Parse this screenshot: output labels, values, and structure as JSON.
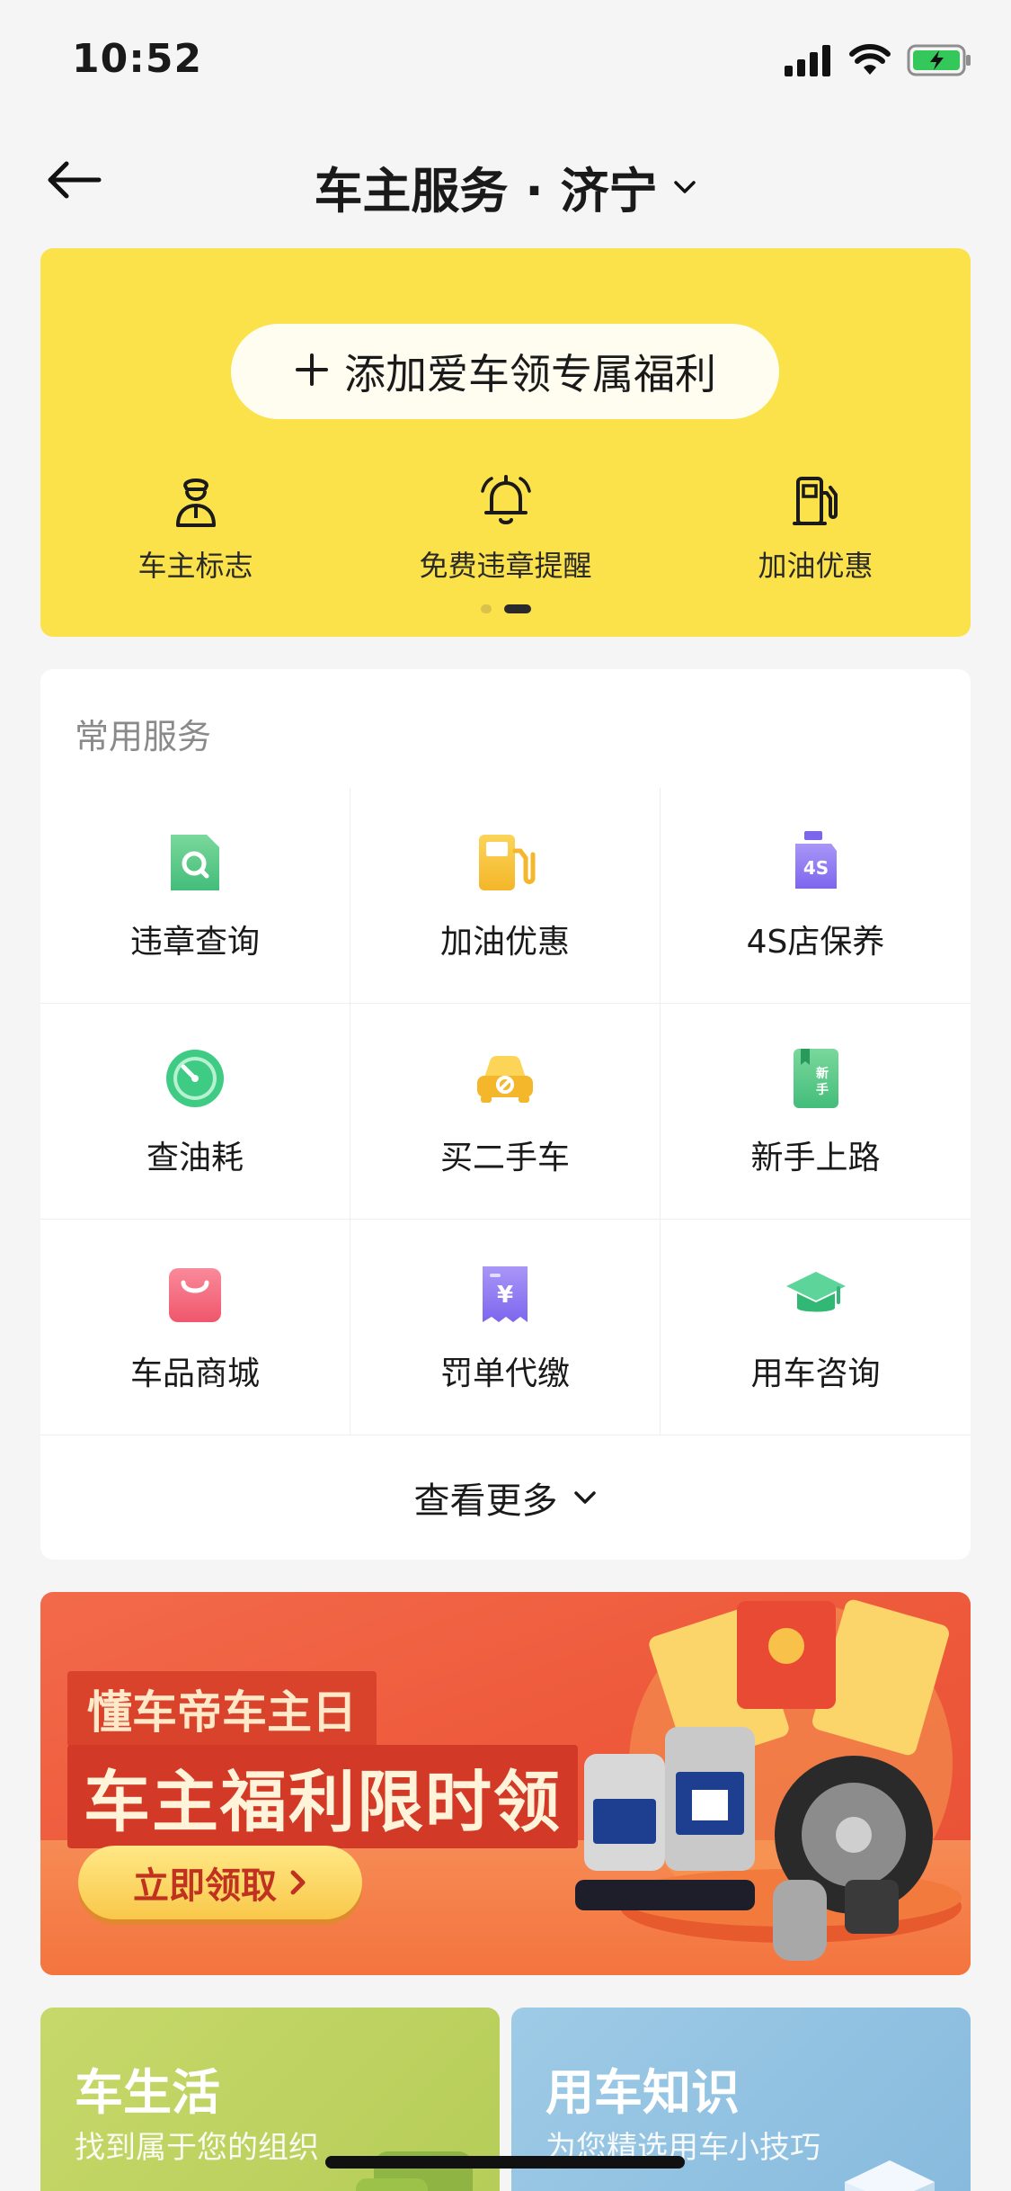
{
  "status_bar": {
    "time": "10:52"
  },
  "nav": {
    "title": "车主服务 · 济宁"
  },
  "welfare": {
    "add_button_label": "添加爱车领专属福利",
    "quick_items": [
      {
        "label": "车主标志",
        "icon": "driver-icon"
      },
      {
        "label": "免费违章提醒",
        "icon": "bell-icon"
      },
      {
        "label": "加油优惠",
        "icon": "fuel-pump-icon"
      }
    ]
  },
  "services": {
    "section_title": "常用服务",
    "items": [
      {
        "label": "违章查询",
        "icon": "violation-query-icon",
        "color": "#5cc98a"
      },
      {
        "label": "加油优惠",
        "icon": "fuel-pump-icon",
        "color": "#f7c338"
      },
      {
        "label": "4S店保养",
        "icon": "4s-maintenance-icon",
        "color": "#8d78f2"
      },
      {
        "label": "查油耗",
        "icon": "fuel-gauge-icon",
        "color": "#3ecb84"
      },
      {
        "label": "买二手车",
        "icon": "used-car-icon",
        "color": "#f7c338"
      },
      {
        "label": "新手上路",
        "icon": "novice-book-icon",
        "color": "#5cc98a"
      },
      {
        "label": "车品商城",
        "icon": "shopping-bag-icon",
        "color": "#f3667a"
      },
      {
        "label": "罚单代缴",
        "icon": "ticket-payment-icon",
        "color": "#8d78f2"
      },
      {
        "label": "用车咨询",
        "icon": "graduation-cap-icon",
        "color": "#3ecb84"
      }
    ],
    "more_label": "查看更多"
  },
  "banner": {
    "tag": "懂车帝车主日",
    "title": "车主福利限时领",
    "button_label": "立即领取"
  },
  "bottom_cards": [
    {
      "title": "车生活",
      "subtitle": "找到属于您的组织"
    },
    {
      "title": "用车知识",
      "subtitle": "为您精选用车小技巧"
    }
  ]
}
